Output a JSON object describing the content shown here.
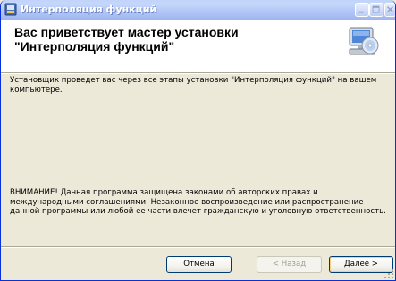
{
  "window": {
    "title": "Интерполяция функций",
    "icon": "installer-app-icon",
    "controls": [
      "minimize-icon",
      "maximize-icon",
      "close-icon"
    ]
  },
  "header": {
    "title": "Вас приветствует мастер установки\n\"Интерполяция функций\"",
    "icon": "computer-cd-icon"
  },
  "main": {
    "intro": "Установщик проведет вас через все этапы установки \"Интерполяция функций\" на вашем компьютере.",
    "warning": "ВНИМАНИЕ! Данная программа защищена законами об авторских правах и международными соглашениями. Незаконное воспроизведение или распространение данной программы или любой ее части влечет гражданскую и уголовную ответственность."
  },
  "buttons": {
    "cancel": "Отмена",
    "back": "< Назад",
    "next": "Далее >"
  },
  "colors": {
    "titlebar": "#b6c9f7",
    "dialog_bg": "#ece9d8",
    "header_bg": "#ffffff",
    "button_border": "#003c74"
  }
}
